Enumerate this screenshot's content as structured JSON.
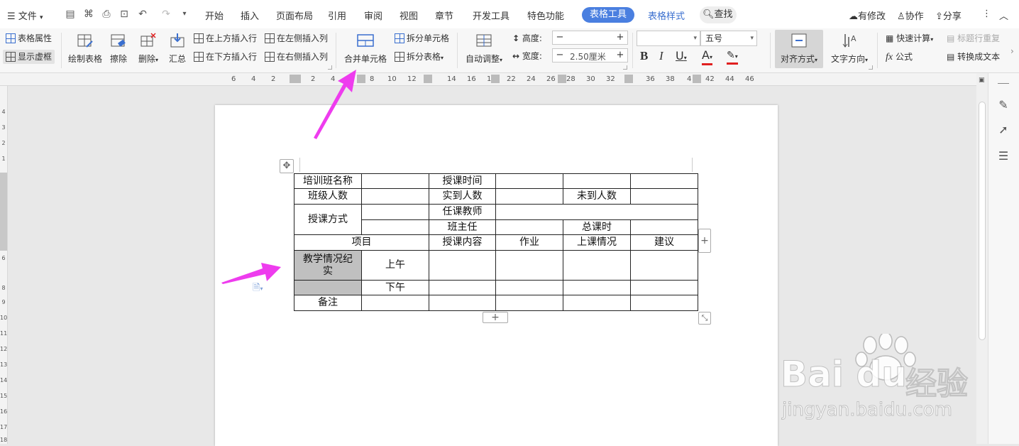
{
  "menubar": {
    "file": "文件",
    "tabs": [
      "开始",
      "插入",
      "页面布局",
      "引用",
      "审阅",
      "视图",
      "章节",
      "开发工具",
      "特色功能"
    ],
    "active_tab": "表格工具",
    "style_tab": "表格样式",
    "search": "查找",
    "right": {
      "modified": "有修改",
      "collab": "协作",
      "share": "分享"
    }
  },
  "ribbon": {
    "table_props": "表格属性",
    "show_grid": "显示虚框",
    "draw_table": "绘制表格",
    "erase": "擦除",
    "delete": "删除",
    "summary": "汇总",
    "insert_above": "在上方插入行",
    "insert_below": "在下方插入行",
    "insert_left": "在左侧插入列",
    "insert_right": "在右侧插入列",
    "merge": "合并单元格",
    "split_cell": "拆分单元格",
    "split_table": "拆分表格",
    "auto_adjust": "自动调整",
    "height_label": "高度:",
    "width_label": "宽度:",
    "width_value": "2.50厘米",
    "font_size": "五号",
    "align": "对齐方式",
    "text_dir": "文字方向",
    "quick_calc": "快速计算",
    "header_repeat": "标题行重复",
    "formula": "公式",
    "to_text": "转换成文本"
  },
  "ruler": {
    "h_ticks": [
      "6",
      "4",
      "2",
      "2",
      "4",
      "8",
      "10",
      "12",
      "14",
      "16",
      "18",
      "22",
      "24",
      "26",
      "28",
      "30",
      "32",
      "36",
      "38",
      "4",
      "42",
      "44",
      "46"
    ],
    "v_ticks": [
      "4",
      "3",
      "2",
      "1",
      "5",
      "6",
      "7",
      "8",
      "9",
      "10",
      "11",
      "12",
      "13",
      "14",
      "15",
      "16",
      "17",
      "18"
    ]
  },
  "doc_table": {
    "r1": {
      "c1": "培训班名称",
      "c3": "授课时间"
    },
    "r2": {
      "c1": "班级人数",
      "c3": "实到人数",
      "c5": "未到人数"
    },
    "r3": {
      "c1": "授课方式",
      "c3": "任课教师"
    },
    "r4": {
      "c3": "班主任",
      "c5": "总课时"
    },
    "r5": {
      "c1": "项目",
      "c3": "授课内容",
      "c4": "作业",
      "c5": "上课情况",
      "c6": "建议"
    },
    "r6": {
      "c1": "教学情况纪实",
      "c2": "上午"
    },
    "r7": {
      "c2": "下午"
    },
    "r8": {
      "c1": "备注"
    }
  },
  "watermark": {
    "logo": "Bai du",
    "exp": "经验",
    "url": "jingyan.baidu.com"
  },
  "colors": {
    "accent": "#4a7fe0",
    "arrow": "#ee3cee",
    "shaded": "#c0c0c0",
    "font_red": "#e02020"
  }
}
